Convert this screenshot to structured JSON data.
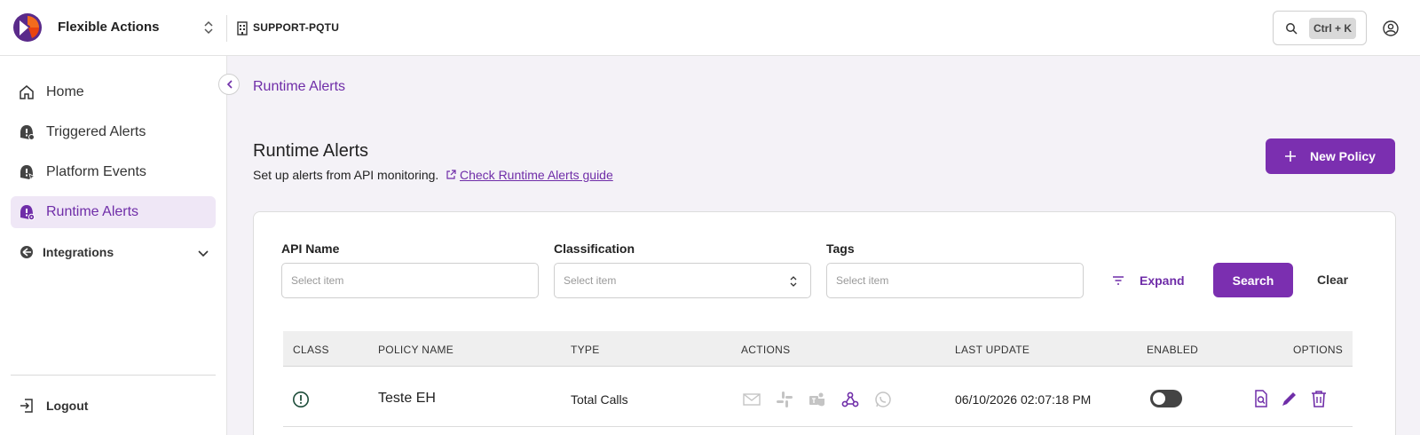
{
  "colors": {
    "accent": "#7b2fb0",
    "accent_text": "#6f2da8",
    "active_bg": "#efe7f6"
  },
  "topbar": {
    "app_name": "Flexible Actions",
    "org_name": "SUPPORT-PQTU",
    "search_shortcut": "Ctrl + K"
  },
  "sidebar": {
    "items": [
      {
        "label": "Home",
        "icon": "home-icon"
      },
      {
        "label": "Triggered Alerts",
        "icon": "alert-bell-icon"
      },
      {
        "label": "Platform Events",
        "icon": "pointer-event-icon"
      },
      {
        "label": "Runtime Alerts",
        "icon": "runtime-alert-icon",
        "active": true
      },
      {
        "label": "Integrations",
        "icon": "integrations-icon"
      }
    ],
    "logout_label": "Logout"
  },
  "main": {
    "breadcrumb": "Runtime Alerts",
    "title": "Runtime Alerts",
    "subtitle": "Set up alerts from API monitoring.",
    "guide_link": "Check Runtime Alerts guide",
    "new_policy_label": "New Policy"
  },
  "filters": {
    "api_name": {
      "label": "API Name",
      "placeholder": "Select item"
    },
    "classification": {
      "label": "Classification",
      "placeholder": "Select item"
    },
    "tags": {
      "label": "Tags",
      "placeholder": "Select item"
    },
    "expand_label": "Expand",
    "search_label": "Search",
    "clear_label": "Clear"
  },
  "table": {
    "columns": [
      "CLASS",
      "POLICY NAME",
      "TYPE",
      "ACTIONS",
      "LAST UPDATE",
      "ENABLED",
      "OPTIONS"
    ],
    "rows": [
      {
        "class_icon": "exclamation-circle-icon",
        "policy_name": "Teste EH",
        "type": "Total Calls",
        "actions": [
          "email-icon",
          "slack-icon",
          "teams-icon",
          "webhook-icon",
          "whatsapp-icon"
        ],
        "last_update": "06/10/2026 02:07:18 PM",
        "enabled": false
      }
    ]
  }
}
